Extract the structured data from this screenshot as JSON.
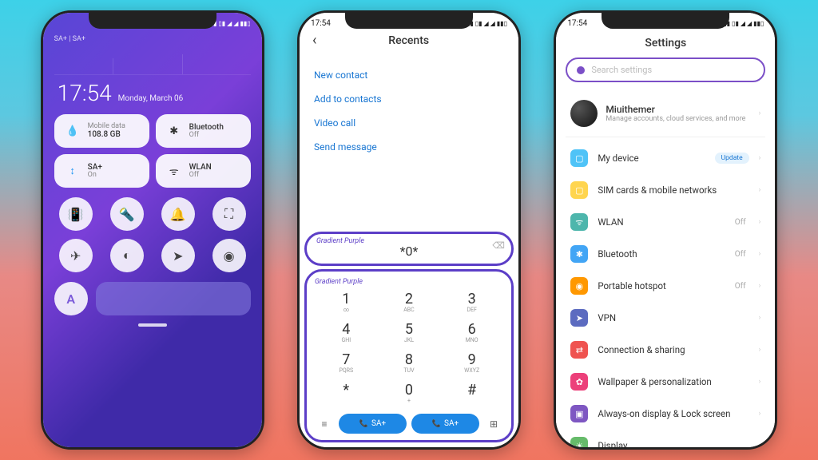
{
  "status": {
    "time": "17:54",
    "icons": "⬚ ▯▮ ▯▮ ◢ ◢ ▮▮▯"
  },
  "p1": {
    "sim": "SA+ | SA+",
    "time": "17:54",
    "date": "Monday, March 06",
    "tiles": [
      {
        "title": "Mobile data",
        "sub": "108.8 GB",
        "icon": "💧"
      },
      {
        "title": "Bluetooth",
        "sub": "Off",
        "icon": "✱"
      },
      {
        "title": "SA+",
        "sub": "On",
        "icon": "↕"
      },
      {
        "title": "WLAN",
        "sub": "Off",
        "icon": "ᯤ"
      }
    ],
    "icons": [
      "📳",
      "🔦",
      "🔔",
      "⛶",
      "✈",
      "◐",
      "➤",
      "◉"
    ],
    "a": "A"
  },
  "p2": {
    "title": "Recents",
    "links": [
      "New contact",
      "Add to contacts",
      "Video call",
      "Send message"
    ],
    "brand": "Gradient Purple",
    "number": "*0*",
    "keys": [
      {
        "n": "1",
        "s": "∞"
      },
      {
        "n": "2",
        "s": "ABC"
      },
      {
        "n": "3",
        "s": "DEF"
      },
      {
        "n": "4",
        "s": "GHI"
      },
      {
        "n": "5",
        "s": "JKL"
      },
      {
        "n": "6",
        "s": "MNO"
      },
      {
        "n": "7",
        "s": "PQRS"
      },
      {
        "n": "8",
        "s": "TUV"
      },
      {
        "n": "9",
        "s": "WXYZ"
      },
      {
        "n": "*",
        "s": ""
      },
      {
        "n": "0",
        "s": "+"
      },
      {
        "n": "#",
        "s": ""
      }
    ],
    "call1": "SA+",
    "call2": "SA+"
  },
  "p3": {
    "title": "Settings",
    "search_placeholder": "Search settings",
    "account": {
      "name": "Miuithemer",
      "sub": "Manage accounts, cloud services, and more"
    },
    "items": [
      {
        "label": "My device",
        "badge": "Update",
        "val": "",
        "bg": "bg-blue",
        "ico": "▢"
      },
      {
        "label": "SIM cards & mobile networks",
        "badge": "",
        "val": "",
        "bg": "bg-yellow",
        "ico": "▢"
      },
      {
        "label": "WLAN",
        "badge": "",
        "val": "Off",
        "bg": "bg-teal",
        "ico": "ᯤ"
      },
      {
        "label": "Bluetooth",
        "badge": "",
        "val": "Off",
        "bg": "bg-blue2",
        "ico": "✱"
      },
      {
        "label": "Portable hotspot",
        "badge": "",
        "val": "Off",
        "bg": "bg-orange",
        "ico": "◉"
      },
      {
        "label": "VPN",
        "badge": "",
        "val": "",
        "bg": "bg-navy",
        "ico": "➤"
      },
      {
        "label": "Connection & sharing",
        "badge": "",
        "val": "",
        "bg": "bg-red",
        "ico": "⇄"
      },
      {
        "label": "Wallpaper & personalization",
        "badge": "",
        "val": "",
        "bg": "bg-pink",
        "ico": "✿"
      },
      {
        "label": "Always-on display & Lock screen",
        "badge": "",
        "val": "",
        "bg": "bg-purple",
        "ico": "▣"
      },
      {
        "label": "Display",
        "badge": "",
        "val": "",
        "bg": "bg-green",
        "ico": "☀"
      }
    ]
  }
}
